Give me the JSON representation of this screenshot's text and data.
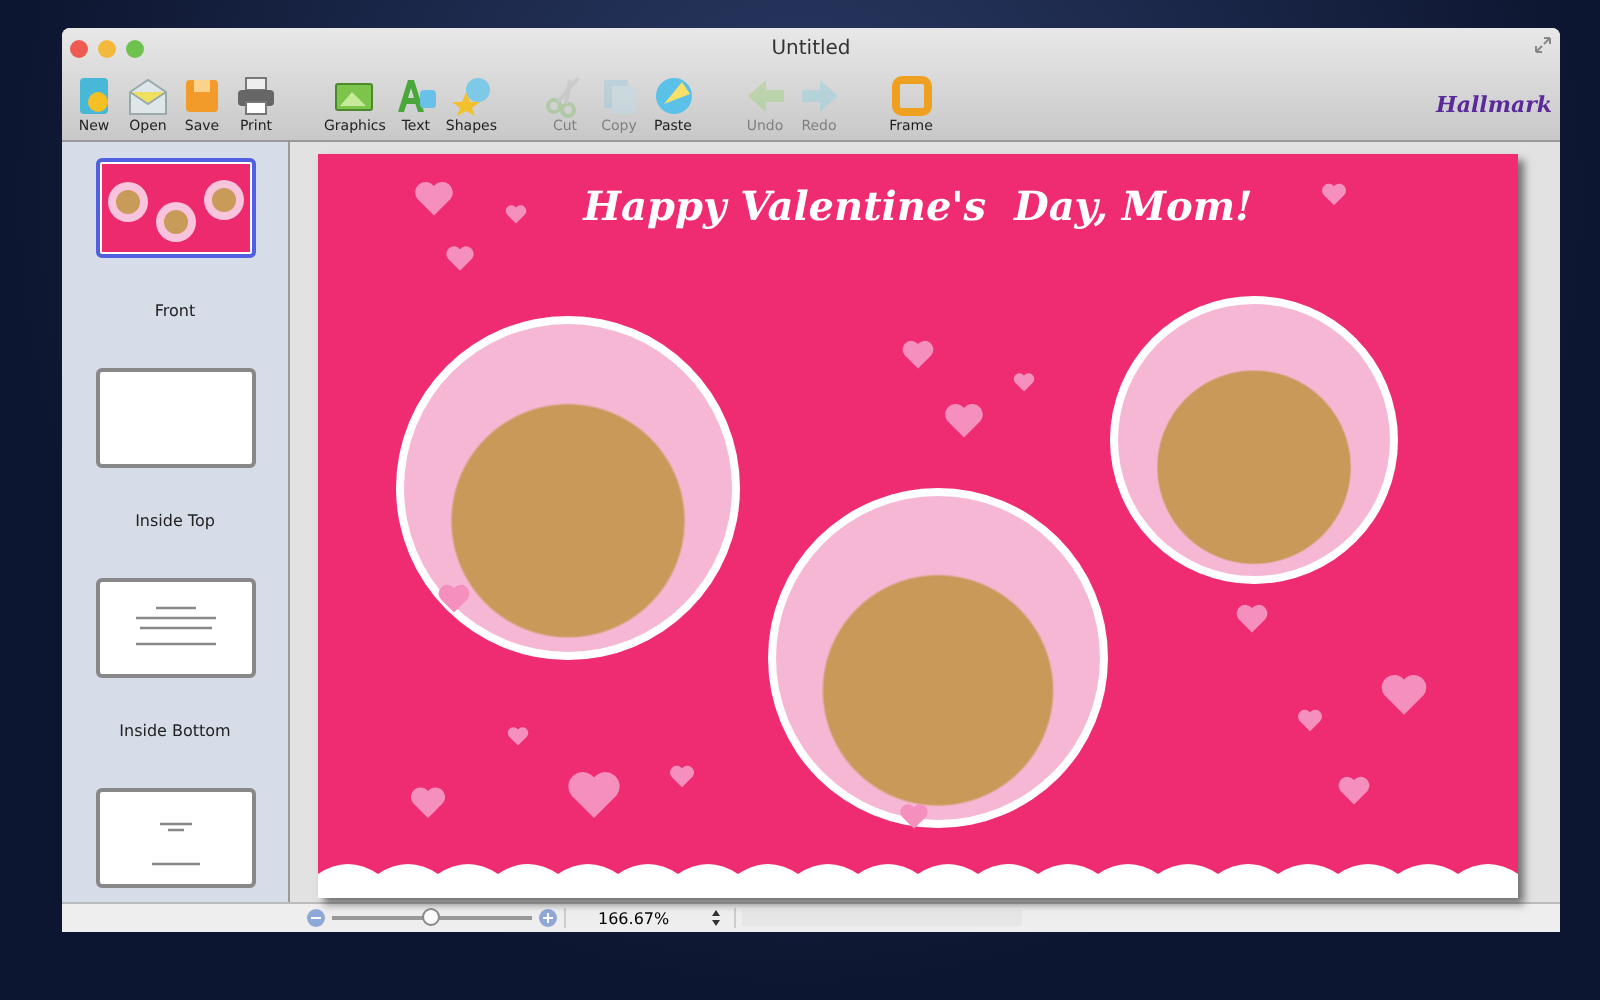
{
  "window": {
    "title": "Untitled"
  },
  "toolbar": [
    {
      "label": "New",
      "disabled": false
    },
    {
      "label": "Open",
      "disabled": false
    },
    {
      "label": "Save",
      "disabled": false
    },
    {
      "label": "Print",
      "disabled": false
    },
    {
      "label": "Graphics",
      "disabled": false
    },
    {
      "label": "Text",
      "disabled": false
    },
    {
      "label": "Shapes",
      "disabled": false
    },
    {
      "label": "Cut",
      "disabled": true
    },
    {
      "label": "Copy",
      "disabled": true
    },
    {
      "label": "Paste",
      "disabled": false
    },
    {
      "label": "Undo",
      "disabled": true
    },
    {
      "label": "Redo",
      "disabled": true
    },
    {
      "label": "Frame",
      "disabled": false
    }
  ],
  "brand": "Hallmark",
  "pages": [
    {
      "label": "Front",
      "selected": true
    },
    {
      "label": "Inside Top",
      "selected": false
    },
    {
      "label": "Inside Bottom",
      "selected": false
    },
    {
      "selected": false
    }
  ],
  "card": {
    "title": "Happy Valentine's  Day, Mom!"
  },
  "zoom": {
    "level": 0.5,
    "value": "166.67%"
  }
}
